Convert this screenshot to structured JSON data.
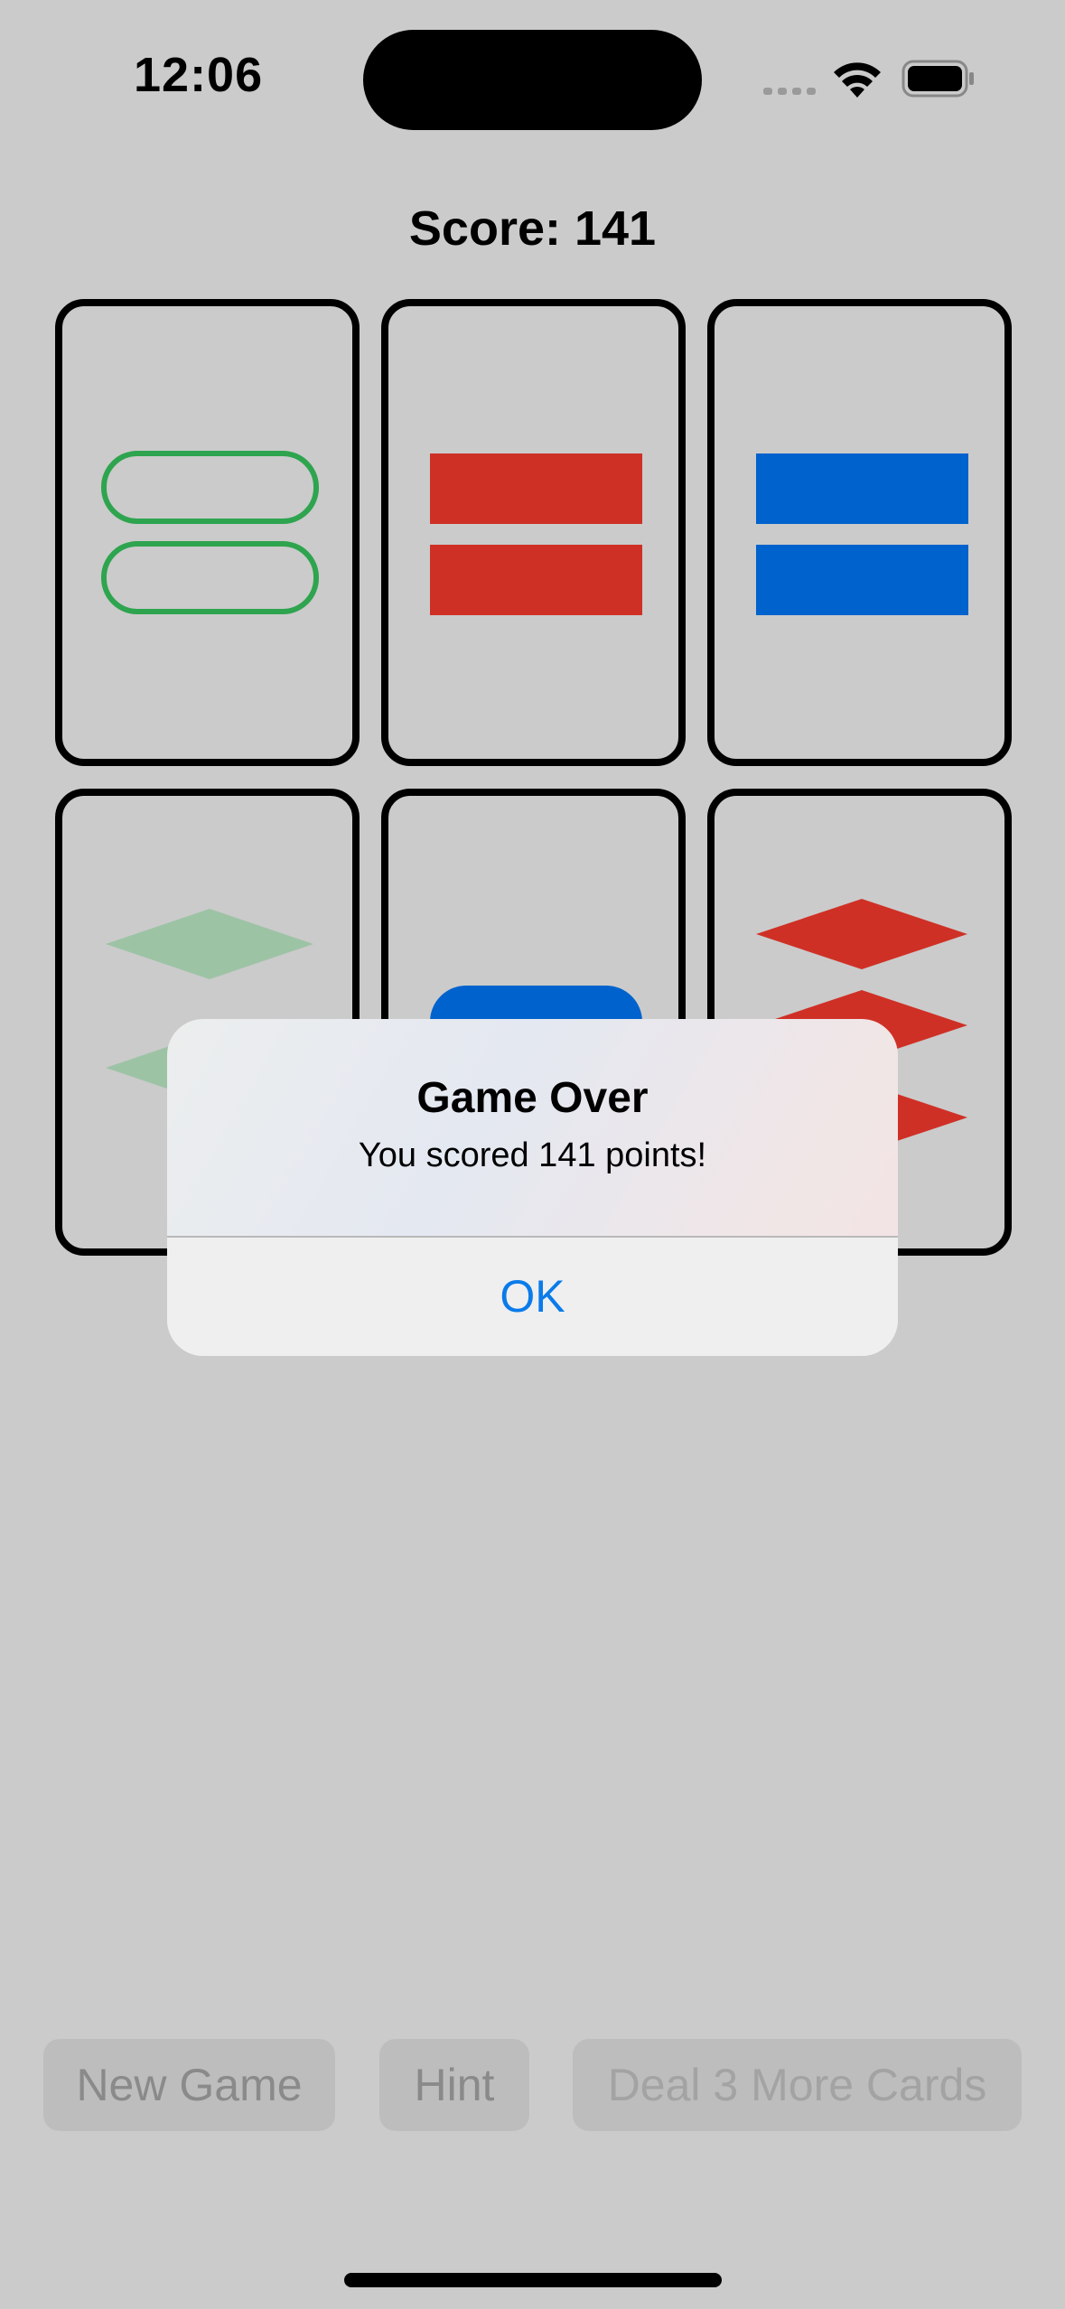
{
  "status_bar": {
    "time": "12:06",
    "icons": [
      "signal-icon",
      "wifi-icon",
      "battery-icon"
    ]
  },
  "score_label": "Score: 141",
  "cards": [
    {
      "shape": "oval",
      "count": 2,
      "color": "#2ea44f",
      "shading": "outline"
    },
    {
      "shape": "rectangle",
      "count": 2,
      "color": "#cf3026",
      "shading": "solid"
    },
    {
      "shape": "rectangle",
      "count": 2,
      "color": "#0062cc",
      "shading": "solid"
    },
    {
      "shape": "diamond",
      "count": 2,
      "color": "#9dc3a5",
      "shading": "striped"
    },
    {
      "shape": "oval",
      "count": 1,
      "color": "#0062cc",
      "shading": "solid"
    },
    {
      "shape": "diamond",
      "count": 3,
      "color": "#cf3026",
      "shading": "solid"
    }
  ],
  "alert": {
    "title": "Game Over",
    "message": "You scored 141 points!",
    "ok_label": "OK",
    "ok_color": "#0a7bea"
  },
  "toolbar": {
    "new_game_label": "New Game",
    "hint_label": "Hint",
    "deal_label": "Deal 3 More Cards"
  }
}
